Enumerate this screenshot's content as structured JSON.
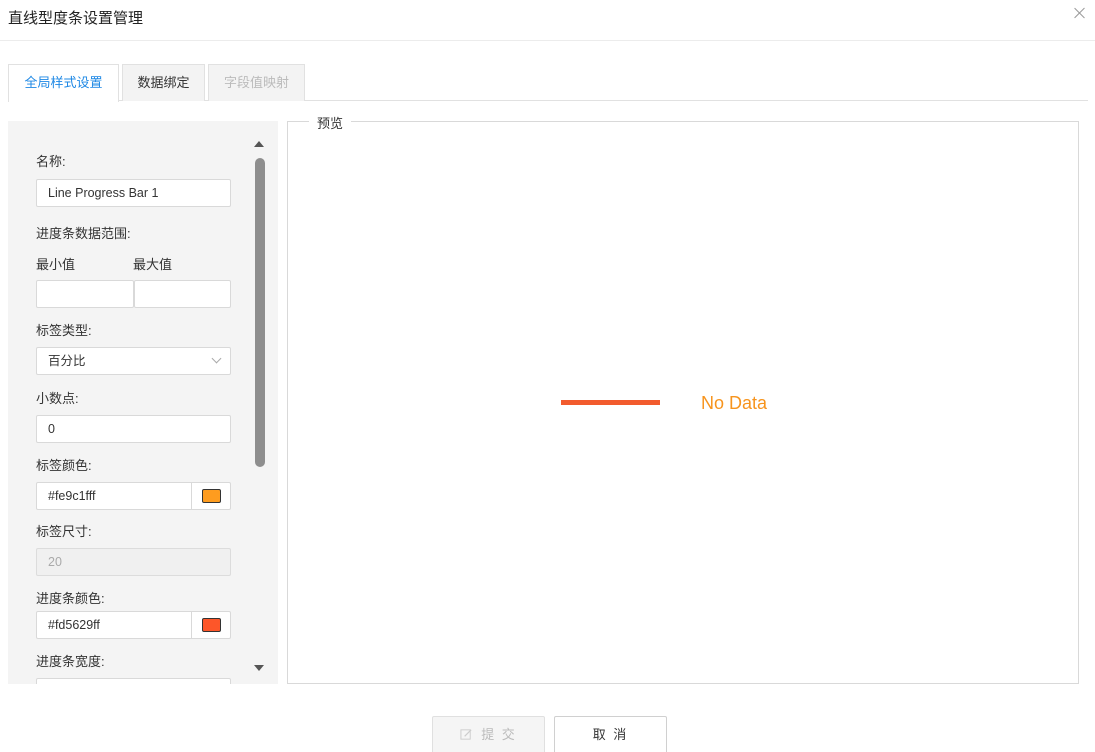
{
  "dialog": {
    "title": "直线型度条设置管理"
  },
  "tabs": [
    {
      "label": "全局样式设置",
      "state": "active"
    },
    {
      "label": "数据绑定",
      "state": "normal"
    },
    {
      "label": "字段值映射",
      "state": "disabled"
    }
  ],
  "form": {
    "name_label": "名称:",
    "name_value": "Line Progress Bar 1",
    "range_label": "进度条数据范围:",
    "min_label": "最小值",
    "max_label": "最大值",
    "min_value": "",
    "max_value": "",
    "label_type_label": "标签类型:",
    "label_type_value": "百分比",
    "decimal_label": "小数点:",
    "decimal_value": "0",
    "label_color_label": "标签颜色:",
    "label_color_value": "#fe9c1fff",
    "label_color_swatch": "#fe9c1f",
    "label_size_label": "标签尺寸:",
    "label_size_value": "20",
    "bar_color_label": "进度条颜色:",
    "bar_color_value": "#fd5629ff",
    "bar_color_swatch": "#fd5629",
    "bar_width_label": "进度条宽度:"
  },
  "preview": {
    "legend": "预览",
    "no_data_text": "No Data",
    "line_color": "#f25b2e",
    "text_color": "#f7941d"
  },
  "footer": {
    "submit_label": "提 交",
    "cancel_label": "取 消"
  }
}
